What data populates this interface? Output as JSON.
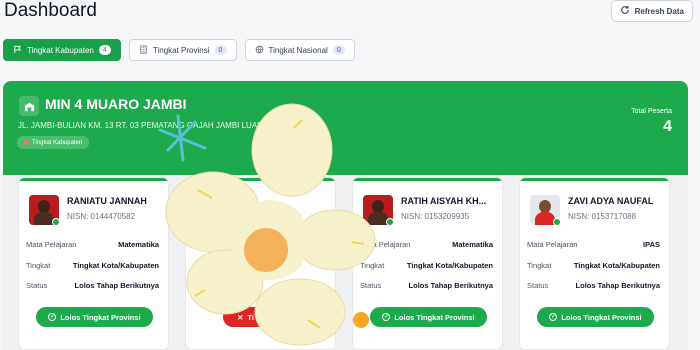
{
  "header": {
    "title": "Dashboard",
    "refresh_label": "Refresh Data"
  },
  "tabs": [
    {
      "label": "Tingkat Kabupaten",
      "count": "4",
      "icon": "flag-icon"
    },
    {
      "label": "Tingkat Provinsi",
      "count": "0",
      "icon": "building-icon"
    },
    {
      "label": "Tingkat Nasional",
      "count": "0",
      "icon": "globe-icon"
    }
  ],
  "school": {
    "name": "MIN 4 MUARO JAMBI",
    "address": "JL. JAMBI-BULIAN KM. 13 RT. 03 PEMATANG GAJAH JAMBI LUAR",
    "address_tail": "JAMBI JAMBI",
    "level": "Tingkat Kabupaten",
    "total_label": "Total Peserta",
    "total": "4"
  },
  "labels": {
    "subject": "Mata Pelajaran",
    "level": "Tingkat",
    "status": "Status"
  },
  "students": [
    {
      "name": "RANIATU JANNAH",
      "nisn": "NISN: 0144470582",
      "subject": "Matematika",
      "level": "Tingkat Kota/Kabupaten",
      "status": "Lolos Tahap Berikutnya",
      "button": "Lolos Tingkat Provinsi"
    },
    {
      "name": "",
      "nisn": "",
      "subject": "",
      "level": "",
      "status": "",
      "button": "Ti"
    },
    {
      "name": "RATIH AISYAH KH...",
      "nisn": "NISN: 0153209935",
      "subject": "Matematika",
      "level": "Tingkat Kota/Kabupaten",
      "status": "Lolos Tahap Berikutnya",
      "button": "Lolos Tingkat Provinsi"
    },
    {
      "name": "ZAVI ADYA NAUFAL",
      "nisn": "NISN: 0153717088",
      "subject": "IPAS",
      "level": "Tingkat Kota/Kabupaten",
      "status": "Lolos Tahap Berikutnya",
      "button": "Lolos Tingkat Provinsi"
    }
  ],
  "colors": {
    "primary": "#1daa4c",
    "danger": "#dc2626",
    "badge_bg": "#e0e7ff",
    "badge_text": "#4f46e5"
  }
}
